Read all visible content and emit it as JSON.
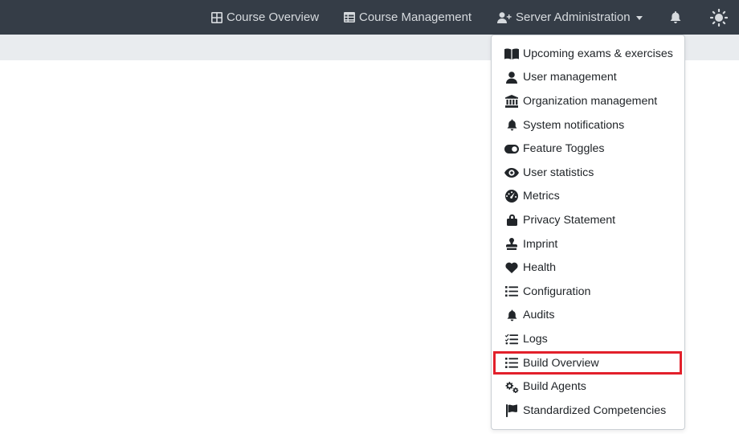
{
  "navbar": {
    "course_overview": "Course Overview",
    "course_management": "Course Management",
    "server_administration": "Server Administration",
    "bell_icon": "bell-icon",
    "theme_icon": "sun-icon"
  },
  "colors": {
    "navbar_bg": "#353d47",
    "subbar_bg": "#e9ecef",
    "highlight_border": "#e2202b"
  },
  "dropdown": {
    "items": [
      {
        "label": "Upcoming exams & exercises",
        "icon": "book-open-icon"
      },
      {
        "label": "User management",
        "icon": "user-icon"
      },
      {
        "label": "Organization management",
        "icon": "university-icon"
      },
      {
        "label": "System notifications",
        "icon": "bell-icon"
      },
      {
        "label": "Feature Toggles",
        "icon": "toggle-on-icon"
      },
      {
        "label": "User statistics",
        "icon": "eye-icon"
      },
      {
        "label": "Metrics",
        "icon": "tachometer-icon"
      },
      {
        "label": "Privacy Statement",
        "icon": "lock-icon"
      },
      {
        "label": "Imprint",
        "icon": "stamp-icon"
      },
      {
        "label": "Health",
        "icon": "heart-icon"
      },
      {
        "label": "Configuration",
        "icon": "list-icon"
      },
      {
        "label": "Audits",
        "icon": "bell-icon"
      },
      {
        "label": "Logs",
        "icon": "tasks-icon"
      },
      {
        "label": "Build Overview",
        "icon": "list-icon",
        "highlighted": true
      },
      {
        "label": "Build Agents",
        "icon": "cogs-icon"
      },
      {
        "label": "Standardized Competencies",
        "icon": "flag-icon"
      }
    ]
  }
}
